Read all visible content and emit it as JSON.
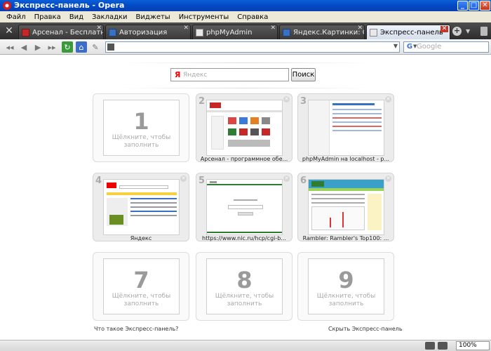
{
  "window": {
    "title": "Экспресс-панель - Opera",
    "controls": [
      "_",
      "□",
      "✕"
    ]
  },
  "menu": [
    "Файл",
    "Правка",
    "Вид",
    "Закладки",
    "Виджеты",
    "Инструменты",
    "Справка"
  ],
  "tabs": [
    {
      "label": "Арсенал - Бесплатный ...",
      "icon": "arsenal-icon",
      "active": false
    },
    {
      "label": "Авторизация",
      "icon": "page-icon",
      "active": false
    },
    {
      "label": "phpMyAdmin",
      "icon": "phpmyadmin-icon",
      "active": false
    },
    {
      "label": "Яндекс.Картинки: Оре...",
      "icon": "page-icon",
      "active": false
    },
    {
      "label": "Экспресс-панель",
      "icon": "speed-dial-icon",
      "active": true
    }
  ],
  "toolbar": {
    "address_value": "",
    "search_placeholder": "Google"
  },
  "speeddial": {
    "search_logo": "Я",
    "search_placeholder": "Яндекс",
    "search_button": "Поиск",
    "empty_hint": "Щёлкните, чтобы заполнить",
    "tiles": [
      {
        "number": "1",
        "filled": false,
        "caption": ""
      },
      {
        "number": "2",
        "filled": true,
        "caption": "Арсенал - программное обе..."
      },
      {
        "number": "3",
        "filled": true,
        "caption": "phpMyAdmin на localhost - p..."
      },
      {
        "number": "4",
        "filled": true,
        "caption": "Яндекс"
      },
      {
        "number": "5",
        "filled": true,
        "caption": "https://www.nic.ru/hcp/cgi-b..."
      },
      {
        "number": "6",
        "filled": true,
        "caption": "Rambler: Rambler's Top100: ..."
      },
      {
        "number": "7",
        "filled": false,
        "caption": ""
      },
      {
        "number": "8",
        "filled": false,
        "caption": ""
      },
      {
        "number": "9",
        "filled": false,
        "caption": ""
      }
    ],
    "what_is_link": "Что такое Экспресс-панель?",
    "hide_link": "Скрыть Экспресс-панель"
  },
  "status": {
    "zoom": "100%"
  }
}
